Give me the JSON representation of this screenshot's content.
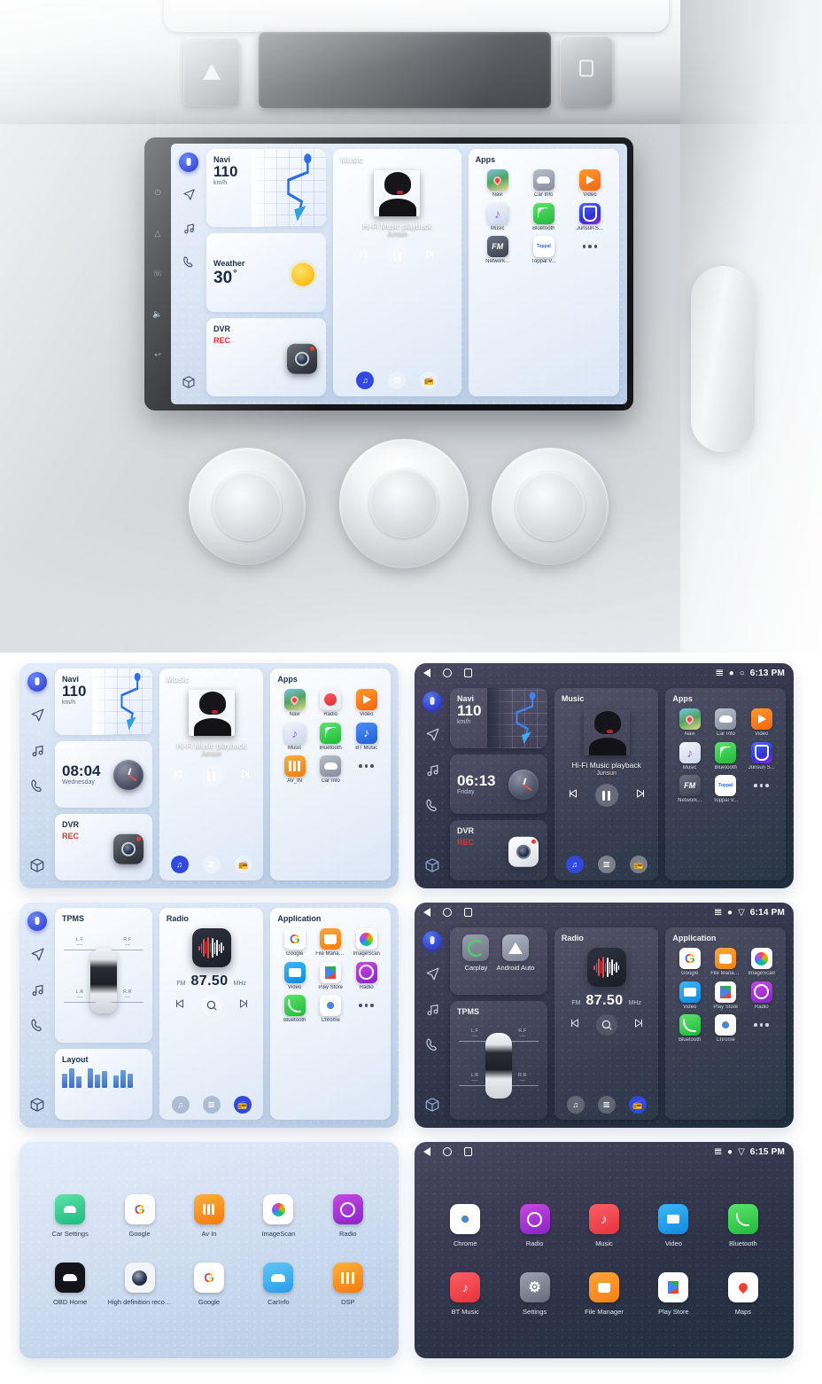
{
  "hero": {
    "alt": "car-dashboard-with-android-head-unit",
    "buttons": {
      "hazard": "hazard-button",
      "lock": "door-lock-button"
    }
  },
  "main_screen": {
    "theme": "light",
    "rail": [
      "voice-assistant",
      "navigation",
      "music",
      "phone",
      "apps"
    ],
    "navi": {
      "title": "Navi",
      "value": "110",
      "unit": "km/h"
    },
    "weather": {
      "title": "Weather",
      "value": "30",
      "degree": "°"
    },
    "dvr": {
      "title": "DVR",
      "status": "REC"
    },
    "music": {
      "title": "Music",
      "track": "Hi-Fi Music playback",
      "artist": "Junsun",
      "sources": [
        "music-source",
        "bluetooth-source",
        "radio-source"
      ]
    },
    "apps": {
      "title": "Apps",
      "items": [
        {
          "label": "Navi",
          "icon": "ic-navi"
        },
        {
          "label": "Car Info",
          "icon": "ic-carinfo"
        },
        {
          "label": "Video",
          "icon": "ic-video"
        },
        {
          "label": "Music",
          "icon": "ic-music"
        },
        {
          "label": "Bluetooth",
          "icon": "ic-bt"
        },
        {
          "label": "Junsun S...",
          "icon": "ic-junsun"
        },
        {
          "label": "Network...",
          "icon": "ic-fm",
          "glyph": "FM"
        },
        {
          "label": "Toppal V...",
          "icon": "ic-toppal",
          "glyph": "Toppal"
        },
        {
          "label": "",
          "icon": "more-dots"
        }
      ]
    }
  },
  "panels": [
    {
      "id": "panel-light-home",
      "theme": "light",
      "statusbar": null,
      "navi": {
        "title": "Navi",
        "value": "110",
        "unit": "km/h"
      },
      "clock": {
        "time": "08:04",
        "day": "Wednesday"
      },
      "dvr": {
        "title": "DVR",
        "status": "REC"
      },
      "music": {
        "title": "Music",
        "track": "Hi-Fi Music playback",
        "artist": "Junsun"
      },
      "apps": {
        "title": "Apps",
        "items": [
          {
            "label": "Navi",
            "icon": "ic-navi"
          },
          {
            "label": "Radio",
            "icon": "ic-radio2"
          },
          {
            "label": "Video",
            "icon": "ic-video"
          },
          {
            "label": "Music",
            "icon": "ic-music"
          },
          {
            "label": "Bluetooth",
            "icon": "ic-bt"
          },
          {
            "label": "BT Music",
            "icon": "ic-btmusic"
          },
          {
            "label": "AV_IN",
            "icon": "ic-avin"
          },
          {
            "label": "Car Info",
            "icon": "ic-carinfo"
          },
          {
            "label": "",
            "icon": "more-dots"
          }
        ]
      }
    },
    {
      "id": "panel-dark-home",
      "theme": "dark",
      "statusbar": {
        "time": "6:13 PM",
        "icons": [
          "bluetooth",
          "location",
          "wifi"
        ]
      },
      "navi": {
        "title": "Navi",
        "value": "110",
        "unit": "km/h"
      },
      "clock": {
        "time": "06:13",
        "day": "Friday"
      },
      "dvr": {
        "title": "DVR",
        "status": "REC"
      },
      "music": {
        "title": "Music",
        "track": "Hi-Fi Music playback",
        "artist": "Junsun"
      },
      "apps": {
        "title": "Apps",
        "items": [
          {
            "label": "Navi",
            "icon": "ic-navi"
          },
          {
            "label": "Car Info",
            "icon": "ic-carinfo"
          },
          {
            "label": "Video",
            "icon": "ic-video"
          },
          {
            "label": "Music",
            "icon": "ic-music"
          },
          {
            "label": "Bluetooth",
            "icon": "ic-bt"
          },
          {
            "label": "Junsun S...",
            "icon": "ic-junsun"
          },
          {
            "label": "Network...",
            "icon": "ic-fm",
            "glyph": "FM"
          },
          {
            "label": "Toppal V...",
            "icon": "ic-toppal",
            "glyph": "Toppal"
          },
          {
            "label": "",
            "icon": "more-dots"
          }
        ]
      }
    },
    {
      "id": "panel-light-radio",
      "theme": "light",
      "statusbar": null,
      "tpms": {
        "title": "TPMS",
        "wheels": [
          {
            "pos": "L.F",
            "value": "----"
          },
          {
            "pos": "R.F",
            "value": "----"
          },
          {
            "pos": "L.R",
            "value": "----"
          },
          {
            "pos": "R.R",
            "value": "----"
          }
        ]
      },
      "layout": {
        "title": "Layout"
      },
      "radio": {
        "title": "Radio",
        "band": "FM",
        "freq": "87.50",
        "unit": "MHz"
      },
      "application": {
        "title": "Application",
        "items": [
          {
            "label": "Google",
            "icon": "ic-google",
            "glyph": "G"
          },
          {
            "label": "File Manager",
            "icon": "ic-folder"
          },
          {
            "label": "ImageScan",
            "icon": "ic-imagescan"
          },
          {
            "label": "Video",
            "icon": "ic-videoblue"
          },
          {
            "label": "Play Store",
            "icon": "ic-play"
          },
          {
            "label": "Radio",
            "icon": "ic-radiopurple"
          },
          {
            "label": "Bluetooth",
            "icon": "ic-phone-green"
          },
          {
            "label": "Chrome",
            "icon": "ic-chrome"
          },
          {
            "label": "",
            "icon": "more-dots"
          }
        ]
      }
    },
    {
      "id": "panel-dark-radio",
      "theme": "dark",
      "statusbar": {
        "time": "6:14 PM",
        "icons": [
          "bluetooth",
          "location",
          "wifi"
        ]
      },
      "projection": [
        {
          "label": "Carplay",
          "icon": "ic-carplay"
        },
        {
          "label": "Android Auto",
          "icon": "ic-androidauto"
        }
      ],
      "tpms": {
        "title": "TPMS",
        "wheels": [
          {
            "pos": "L.F",
            "value": "----"
          },
          {
            "pos": "R.F",
            "value": "----"
          },
          {
            "pos": "L.R",
            "value": "----"
          },
          {
            "pos": "R.R",
            "value": "----"
          }
        ]
      },
      "radio": {
        "title": "Radio",
        "band": "FM",
        "freq": "87.50",
        "unit": "MHz"
      },
      "application": {
        "title": "Application",
        "items": [
          {
            "label": "Google",
            "icon": "ic-google",
            "glyph": "G"
          },
          {
            "label": "File Manager",
            "icon": "ic-folder"
          },
          {
            "label": "ImageScan",
            "icon": "ic-imagescan"
          },
          {
            "label": "Video",
            "icon": "ic-videoblue"
          },
          {
            "label": "Play Store",
            "icon": "ic-play"
          },
          {
            "label": "Radio",
            "icon": "ic-radiopurple"
          },
          {
            "label": "Bluetooth",
            "icon": "ic-phone-green"
          },
          {
            "label": "Chrome",
            "icon": "ic-chrome"
          },
          {
            "label": "",
            "icon": "more-dots"
          }
        ]
      }
    },
    {
      "id": "panel-light-launcher",
      "theme": "light",
      "statusbar": null,
      "launcher": {
        "rows": [
          [
            {
              "label": "Car Settings",
              "icon": "ic-carsettings"
            },
            {
              "label": "Google",
              "icon": "ic-google",
              "glyph": "G"
            },
            {
              "label": "Av In",
              "icon": "ic-avin"
            },
            {
              "label": "ImageScan",
              "icon": "ic-imagescan"
            },
            {
              "label": "Radio",
              "icon": "ic-radiopurple"
            }
          ],
          [
            {
              "label": "OBD Home",
              "icon": "ic-obd"
            },
            {
              "label": "High definition recor...",
              "icon": "ic-hdrec"
            },
            {
              "label": "Google",
              "icon": "ic-google",
              "glyph": "G"
            },
            {
              "label": "CarInfo",
              "icon": "ic-carinfo-blue"
            },
            {
              "label": "DSP",
              "icon": "ic-dsp"
            }
          ]
        ]
      }
    },
    {
      "id": "panel-dark-launcher",
      "theme": "dark",
      "statusbar": {
        "time": "6:15 PM",
        "icons": [
          "bluetooth",
          "location",
          "wifi"
        ]
      },
      "launcher": {
        "rows": [
          [
            {
              "label": "Chrome",
              "icon": "ic-chrome"
            },
            {
              "label": "Radio",
              "icon": "ic-radiopurple"
            },
            {
              "label": "Music",
              "icon": "ic-musicred"
            },
            {
              "label": "Video",
              "icon": "ic-videoblue"
            },
            {
              "label": "Bluetooth",
              "icon": "ic-phone-green"
            }
          ],
          [
            {
              "label": "BT Music",
              "icon": "ic-btmusicred"
            },
            {
              "label": "Settings",
              "icon": "ic-settings"
            },
            {
              "label": "File Manager",
              "icon": "ic-folder"
            },
            {
              "label": "Play Store",
              "icon": "ic-play"
            },
            {
              "label": "Maps",
              "icon": "ic-maps"
            }
          ]
        ]
      }
    }
  ],
  "colors": {
    "accent_blue": "#3149e0",
    "rec_red": "#e0342a",
    "light_bg": "#d3e0f2",
    "dark_bg": "#3b3a52"
  }
}
